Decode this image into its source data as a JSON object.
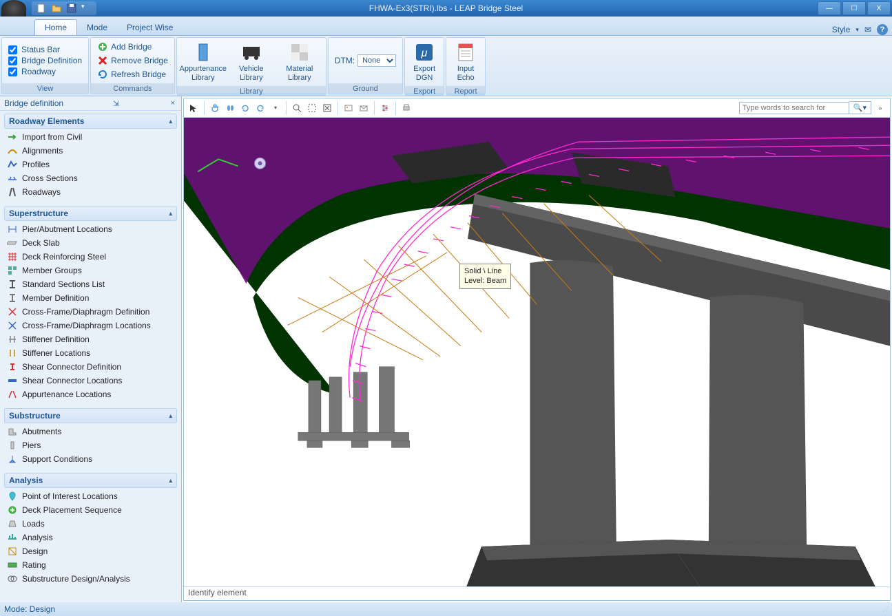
{
  "window": {
    "title": "FHWA-Ex3(STRI).lbs - LEAP Bridge Steel"
  },
  "tabs": {
    "home": "Home",
    "mode": "Mode",
    "projectwise": "Project Wise",
    "style": "Style"
  },
  "ribbon": {
    "view": {
      "label": "View",
      "status_bar": "Status Bar",
      "bridge_def": "Bridge Definition",
      "roadway": "Roadway"
    },
    "commands": {
      "label": "Commands",
      "add": "Add Bridge",
      "remove": "Remove Bridge",
      "refresh": "Refresh Bridge"
    },
    "library": {
      "label": "Library",
      "appurtenance": "Appurtenance Library",
      "vehicle": "Vehicle Library",
      "material": "Material Library"
    },
    "ground": {
      "label": "Ground",
      "dtm_label": "DTM:",
      "dtm_value": "None"
    },
    "export": {
      "label": "Export",
      "dgn": "Export DGN"
    },
    "report": {
      "label": "Report",
      "input_echo": "Input Echo"
    }
  },
  "sidepanel": {
    "title": "Bridge definition",
    "sections": {
      "roadway": {
        "label": "Roadway Elements",
        "items": [
          "Import from Civil",
          "Alignments",
          "Profiles",
          "Cross Sections",
          "Roadways"
        ]
      },
      "super": {
        "label": "Superstructure",
        "items": [
          "Pier/Abutment Locations",
          "Deck Slab",
          "Deck Reinforcing Steel",
          "Member Groups",
          "Standard Sections List",
          "Member Definition",
          "Cross-Frame/Diaphragm Definition",
          "Cross-Frame/Diaphragm Locations",
          "Stiffener Definition",
          "Stiffener Locations",
          "Shear Connector Definition",
          "Shear Connector Locations",
          "Appurtenance Locations"
        ]
      },
      "sub": {
        "label": "Substructure",
        "items": [
          "Abutments",
          "Piers",
          "Support Conditions"
        ]
      },
      "analysis": {
        "label": "Analysis",
        "items": [
          "Point of Interest Locations",
          "Deck Placement Sequence",
          "Loads",
          "Analysis",
          "Design",
          "Rating",
          "Substructure Design/Analysis"
        ]
      }
    }
  },
  "viewport": {
    "search_placeholder": "Type words to search for",
    "tooltip_line1": "Solid \\ Line",
    "tooltip_line2": "Level: Beam",
    "status_text": "Identify element"
  },
  "statusbar": {
    "mode": "Mode: Design"
  }
}
